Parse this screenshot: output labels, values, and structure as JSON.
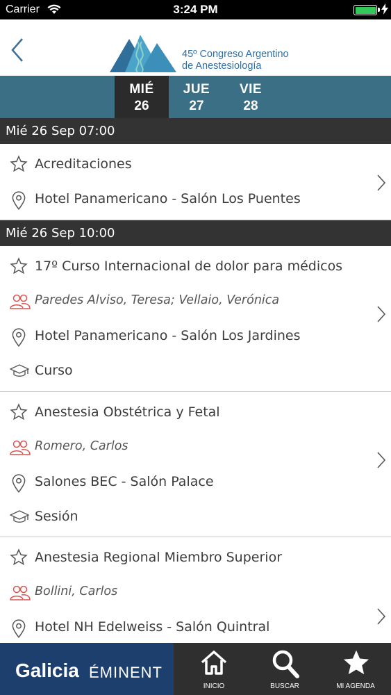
{
  "status_bar": {
    "carrier": "Carrier",
    "time": "3:24 PM"
  },
  "header": {
    "logo_line1": "45º Congreso Argentino",
    "logo_line2": "de Anestesiología"
  },
  "day_tabs": [
    {
      "day": "MIÉ",
      "num": "26",
      "active": true
    },
    {
      "day": "JUE",
      "num": "27",
      "active": false
    },
    {
      "day": "VIE",
      "num": "28",
      "active": false
    }
  ],
  "sections": [
    {
      "header": "Mié 26 Sep 07:00",
      "events": [
        {
          "title": "Acreditaciones",
          "location": "Hotel Panamericano - Salón Los Puentes"
        }
      ]
    },
    {
      "header": "Mié 26 Sep 10:00",
      "events": [
        {
          "title": "17º Curso Internacional de dolor para médicos",
          "speakers": "Paredes Alviso, Teresa; Vellaio, Verónica",
          "location": "Hotel Panamericano - Salón Los Jardines",
          "type": "Curso"
        },
        {
          "title": "Anestesia Obstétrica y Fetal",
          "speakers": "Romero, Carlos",
          "location": "Salones BEC - Salón Palace",
          "type": "Sesión"
        },
        {
          "title": "Anestesia Regional Miembro Superior",
          "speakers": "Bollini, Carlos",
          "location": "Hotel NH Edelweiss - Salón Quintral"
        }
      ]
    }
  ],
  "bottom_bar": {
    "brand_main": "Galicia",
    "brand_sub": "ÉMINENT",
    "nav": [
      {
        "label": "INICIO",
        "icon": "home-icon"
      },
      {
        "label": "BUSCAR",
        "icon": "search-icon"
      },
      {
        "label": "MI AGENDA",
        "icon": "star-icon"
      }
    ]
  },
  "colors": {
    "tabs_bg": "#3a6f86",
    "active_tab_bg": "#2b2b2b",
    "section_header_bg": "#333333",
    "speaker_icon": "#d9534f",
    "brand_bg": "#1c3f6e"
  }
}
